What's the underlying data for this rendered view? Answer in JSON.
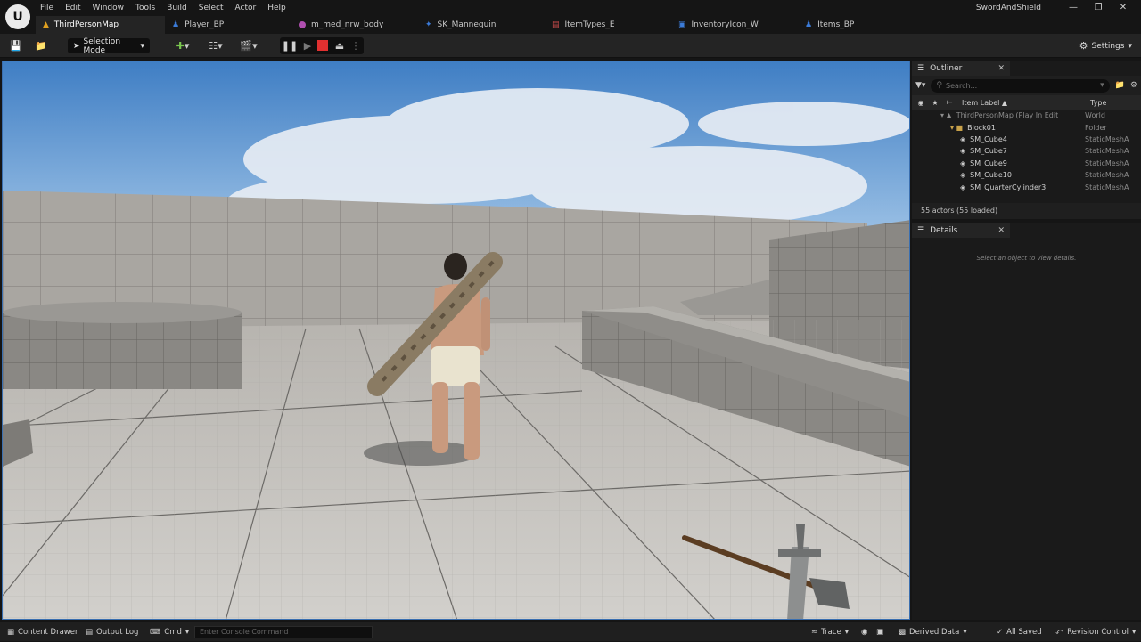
{
  "app": {
    "project_name": "SwordAndShield",
    "logo": "U"
  },
  "menu": [
    "File",
    "Edit",
    "Window",
    "Tools",
    "Build",
    "Select",
    "Actor",
    "Help"
  ],
  "tabs": [
    {
      "label": "ThirdPersonMap",
      "icon": "level-icon",
      "color": "#e0a020"
    },
    {
      "label": "Player_BP",
      "icon": "blueprint-icon",
      "color": "#3b7bd8"
    },
    {
      "label": "m_med_nrw_body",
      "icon": "material-icon",
      "color": "#b04fb0"
    },
    {
      "label": "SK_Mannequin",
      "icon": "skeleton-icon",
      "color": "#3b7bd8"
    },
    {
      "label": "ItemTypes_E",
      "icon": "enum-icon",
      "color": "#c84a4a"
    },
    {
      "label": "InventoryIcon_W",
      "icon": "widget-icon",
      "color": "#3b7bd8"
    },
    {
      "label": "Items_BP",
      "icon": "blueprint-icon",
      "color": "#3b7bd8"
    }
  ],
  "toolbar": {
    "selection_mode": "Selection Mode",
    "settings": "Settings"
  },
  "outliner": {
    "title": "Outliner",
    "search_placeholder": "Search...",
    "col_label": "Item Label",
    "col_type": "Type",
    "rows": [
      {
        "label": "ThirdPersonMap (Play In Edit",
        "type": "World",
        "indent": 2,
        "kind": "world"
      },
      {
        "label": "Block01",
        "type": "Folder",
        "indent": 3,
        "kind": "folder"
      },
      {
        "label": "SM_Cube4",
        "type": "StaticMeshA",
        "indent": 4,
        "kind": "mesh"
      },
      {
        "label": "SM_Cube7",
        "type": "StaticMeshA",
        "indent": 4,
        "kind": "mesh"
      },
      {
        "label": "SM_Cube9",
        "type": "StaticMeshA",
        "indent": 4,
        "kind": "mesh"
      },
      {
        "label": "SM_Cube10",
        "type": "StaticMeshA",
        "indent": 4,
        "kind": "mesh"
      },
      {
        "label": "SM_QuarterCylinder3",
        "type": "StaticMeshA",
        "indent": 4,
        "kind": "mesh"
      }
    ],
    "actors_count": "55 actors (55 loaded)"
  },
  "details": {
    "title": "Details",
    "empty_text": "Select an object to view details."
  },
  "statusbar": {
    "content_drawer": "Content Drawer",
    "output_log": "Output Log",
    "cmd": "Cmd",
    "console_placeholder": "Enter Console Command",
    "trace": "Trace",
    "derived_data": "Derived Data",
    "all_saved": "All Saved",
    "revision_control": "Revision Control"
  }
}
